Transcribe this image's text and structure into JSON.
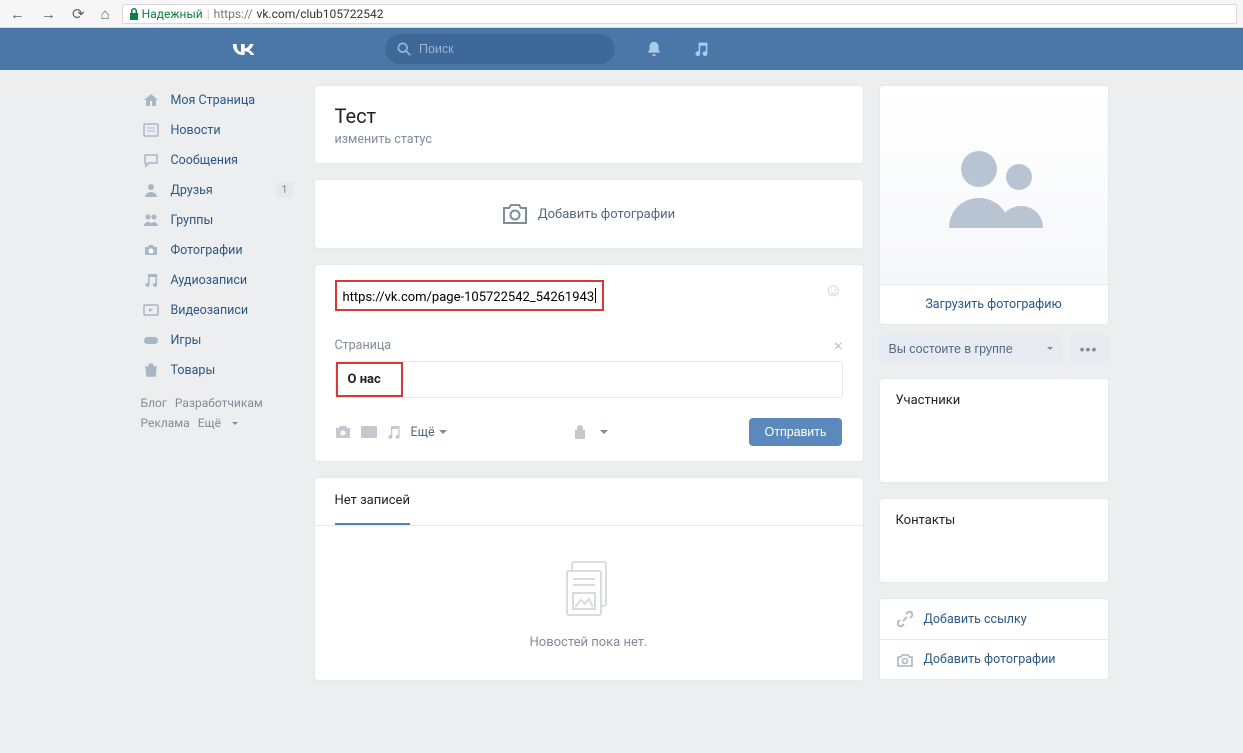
{
  "chrome": {
    "secure_label": "Надежный",
    "url_host": "https://",
    "url_path": "vk.com/club105722542"
  },
  "header": {
    "search_placeholder": "Поиск"
  },
  "sidebar": {
    "items": [
      {
        "icon": "home",
        "label": "Моя Страница"
      },
      {
        "icon": "news",
        "label": "Новости"
      },
      {
        "icon": "msg",
        "label": "Сообщения"
      },
      {
        "icon": "friends",
        "label": "Друзья",
        "badge": "1"
      },
      {
        "icon": "groups",
        "label": "Группы"
      },
      {
        "icon": "photos",
        "label": "Фотографии"
      },
      {
        "icon": "audio",
        "label": "Аудиозаписи"
      },
      {
        "icon": "video",
        "label": "Видеозаписи"
      },
      {
        "icon": "games",
        "label": "Игры"
      },
      {
        "icon": "market",
        "label": "Товары"
      }
    ],
    "footer": {
      "blog": "Блог",
      "dev": "Разработчикам",
      "ads": "Реклама",
      "more": "Ещё"
    }
  },
  "group": {
    "title": "Тест",
    "status_action": "изменить статус",
    "add_photos": "Добавить фотографии"
  },
  "post": {
    "input_text": "https://vk.com/page-105722542_54261943",
    "attachment_label": "Страница",
    "attachment_title": "О нас",
    "more": "Ещё",
    "send": "Отправить"
  },
  "wall": {
    "tab": "Нет записей",
    "empty": "Новостей пока нет."
  },
  "right": {
    "upload": "Загрузить фотографию",
    "member": "Вы состоите в группе",
    "members_title": "Участники",
    "contacts_title": "Контакты",
    "add_link": "Добавить ссылку",
    "add_photos_side": "Добавить фотографии"
  }
}
